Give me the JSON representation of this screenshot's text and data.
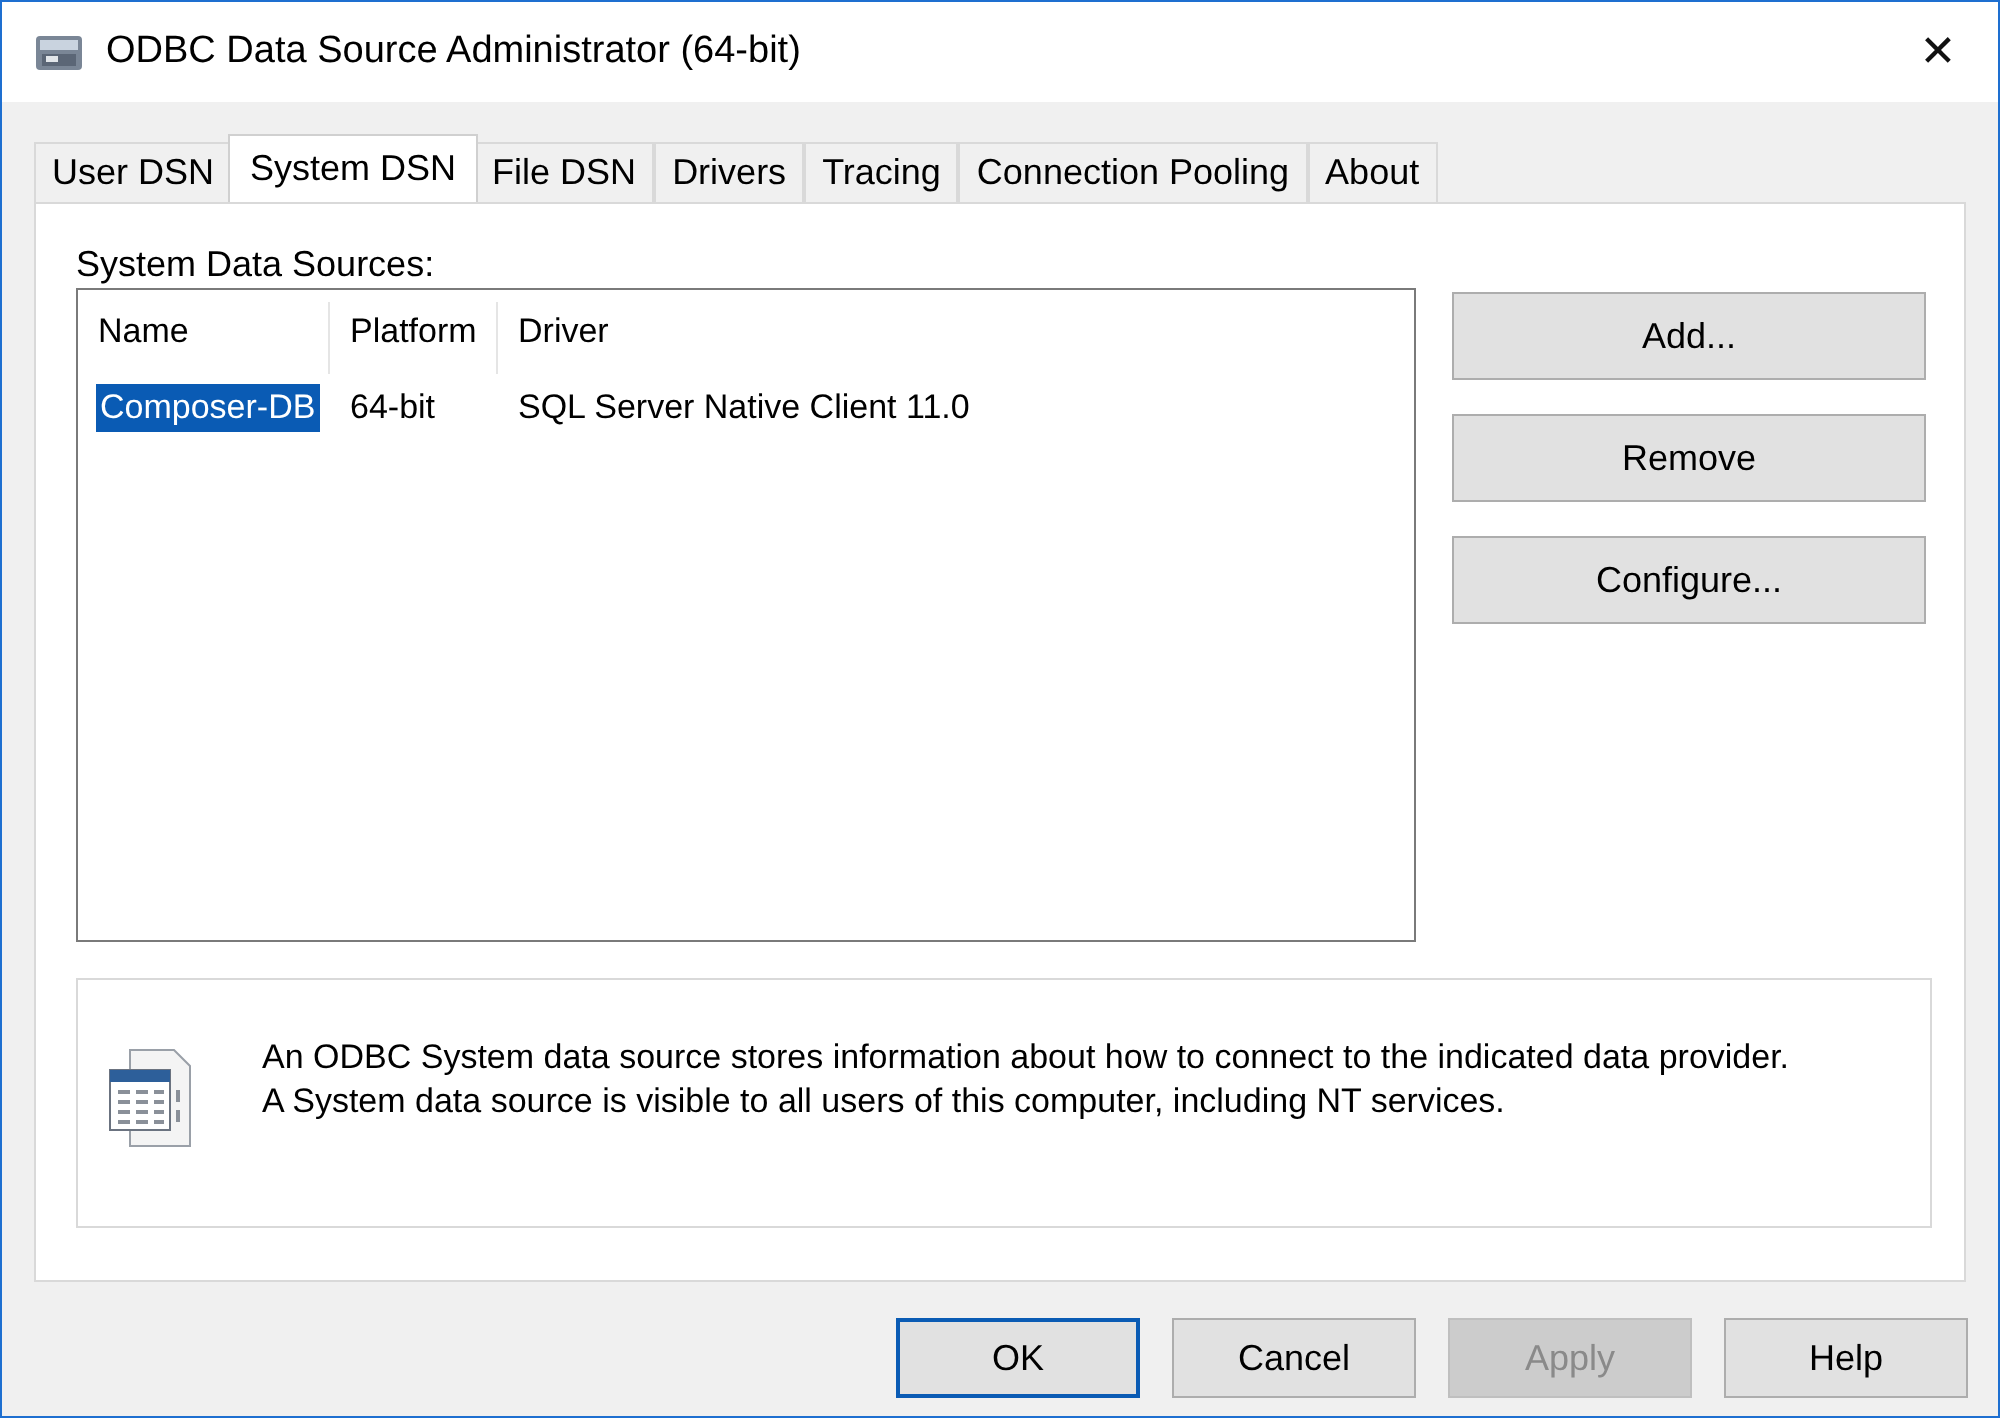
{
  "window": {
    "title": "ODBC Data Source Administrator (64-bit)",
    "close": "✕"
  },
  "tabs": [
    {
      "label": "User DSN",
      "selected": false
    },
    {
      "label": "System DSN",
      "selected": true
    },
    {
      "label": "File DSN",
      "selected": false
    },
    {
      "label": "Drivers",
      "selected": false
    },
    {
      "label": "Tracing",
      "selected": false
    },
    {
      "label": "Connection Pooling",
      "selected": false
    },
    {
      "label": "About",
      "selected": false
    }
  ],
  "list_label": "System Data Sources:",
  "table": {
    "columns": [
      "Name",
      "Platform",
      "Driver"
    ],
    "rows": [
      {
        "cells": [
          "Composer-DB",
          "64-bit",
          "SQL Server Native Client 11.0"
        ],
        "selected": true
      }
    ]
  },
  "side_buttons": [
    "Add...",
    "Remove",
    "Configure..."
  ],
  "info": {
    "lines": [
      "An ODBC System data source stores information about how to connect to the indicated data provider.",
      "A System data source is visible to all users of this computer, including NT services."
    ]
  },
  "buttons": [
    {
      "label": "OK",
      "default": true,
      "disabled": false
    },
    {
      "label": "Cancel",
      "default": false,
      "disabled": false
    },
    {
      "label": "Apply",
      "default": false,
      "disabled": true
    },
    {
      "label": "Help",
      "default": false,
      "disabled": false
    }
  ]
}
